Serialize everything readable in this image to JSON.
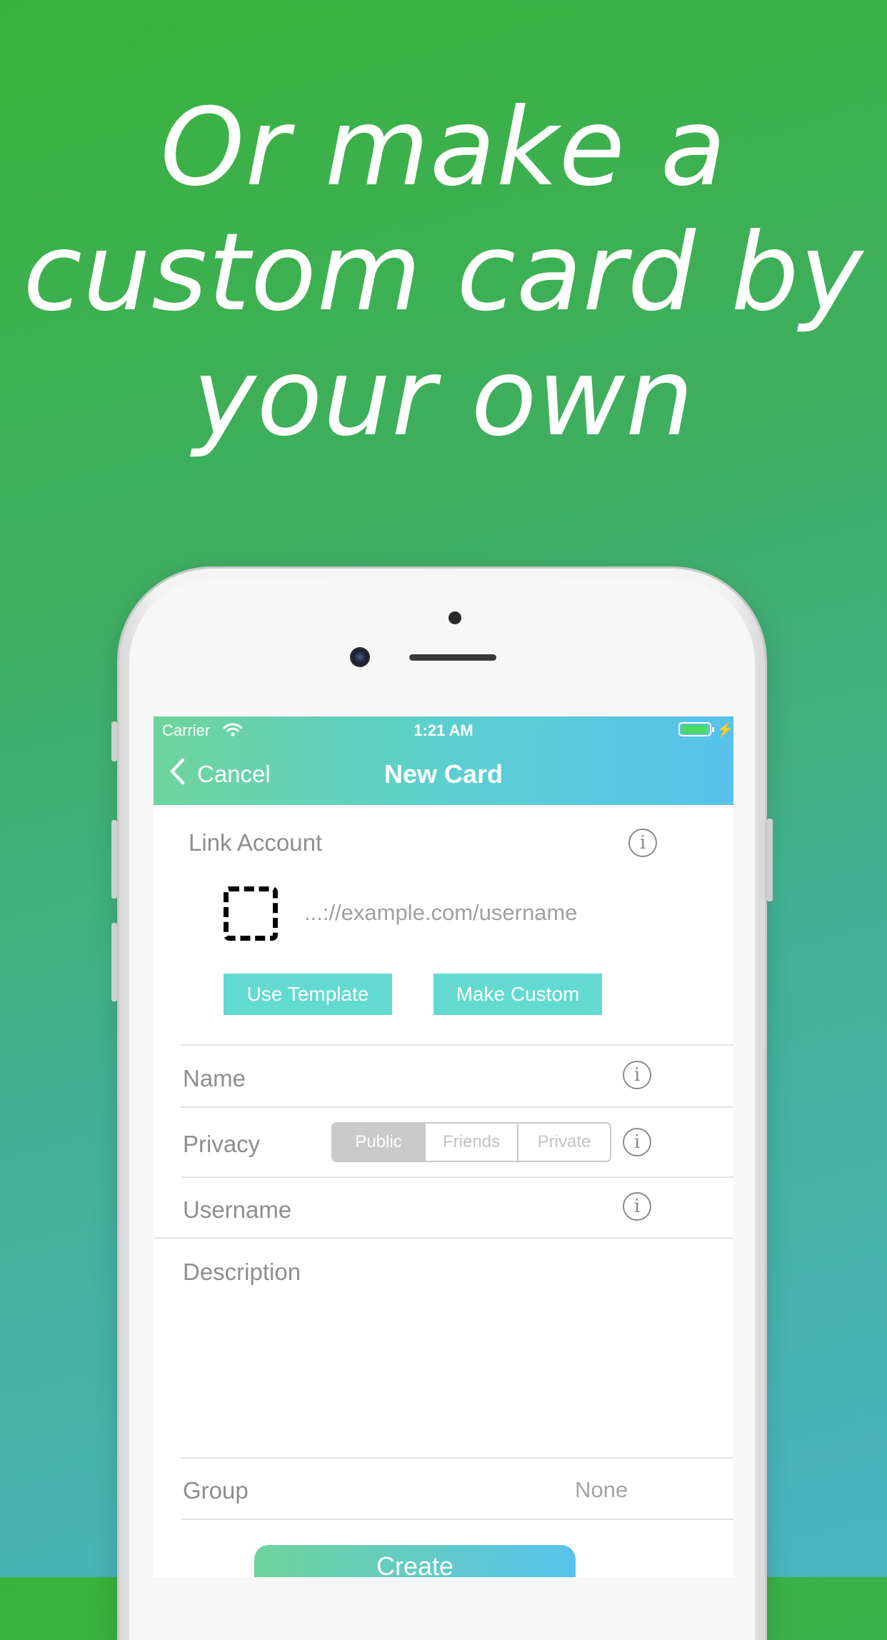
{
  "headline": {
    "line1": "Or make a",
    "line2": "custom card by",
    "line3": "your own"
  },
  "status_bar": {
    "carrier": "Carrier",
    "time": "1:21 AM",
    "battery_color": "#4cd964"
  },
  "navbar": {
    "back_label": "Cancel",
    "title": "New Card"
  },
  "link_account": {
    "label": "Link Account",
    "url_placeholder": "...://example.com/username",
    "use_template_label": "Use Template",
    "make_custom_label": "Make Custom"
  },
  "form": {
    "name_label": "Name",
    "privacy_label": "Privacy",
    "privacy_options": [
      "Public",
      "Friends",
      "Private"
    ],
    "privacy_selected": "Public",
    "username_label": "Username",
    "description_label": "Description",
    "group_label": "Group",
    "group_value": "None",
    "create_label": "Create"
  },
  "info_glyph": "i",
  "colors": {
    "accent_teal": "#62dad2",
    "nav_gradient_start": "#6fd49c",
    "nav_gradient_end": "#58c2ec"
  }
}
